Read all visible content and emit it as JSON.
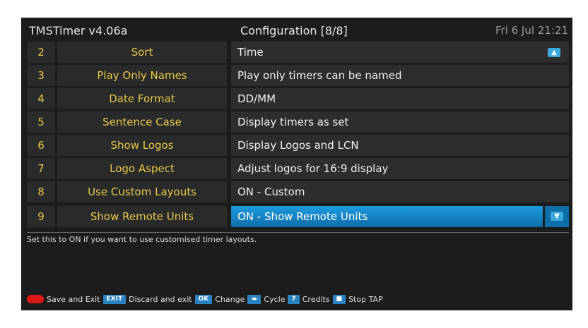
{
  "header": {
    "app_title": "TMSTimer v4.06a",
    "screen_title": "Configuration [8/8]",
    "datetime": "Fri 6 Jul 21:21"
  },
  "rows": [
    {
      "num": "2",
      "name": "Sort",
      "value": "Time"
    },
    {
      "num": "3",
      "name": "Play Only Names",
      "value": "Play only timers can be named"
    },
    {
      "num": "4",
      "name": "Date Format",
      "value": "DD/MM"
    },
    {
      "num": "5",
      "name": "Sentence Case",
      "value": "Display timers as set"
    },
    {
      "num": "6",
      "name": "Show Logos",
      "value": "Display Logos and LCN"
    },
    {
      "num": "7",
      "name": "Logo Aspect",
      "value": "Adjust logos for 16:9 display"
    },
    {
      "num": "8",
      "name": "Use Custom Layouts",
      "value": "ON - Custom"
    },
    {
      "num": "9",
      "name": "Show Remote Units",
      "value": "ON - Show Remote Units"
    }
  ],
  "selected_row": "9",
  "help_text": "Set this to ON if you want to use customised timer layouts.",
  "footer": {
    "save_exit": "Save and Exit",
    "exit_key": "EXIT",
    "discard_exit": "Discard and exit",
    "ok_key": "OK",
    "change": "Change",
    "cycle_key": "◂▸",
    "cycle": "Cycle",
    "credits_key": "7",
    "credits": "Credits",
    "stop": "Stop TAP"
  },
  "icons": {
    "scroll_up": "arrow-up-icon",
    "scroll_down": "arrow-down-icon",
    "red_button": "red-button-icon",
    "stop_key": "stop-key-icon"
  },
  "colors": {
    "label": "#e8c84a",
    "selection": "#1c9be0",
    "background": "#1c1c1c",
    "red_button": "#e01818",
    "key": "#2a84c4"
  }
}
